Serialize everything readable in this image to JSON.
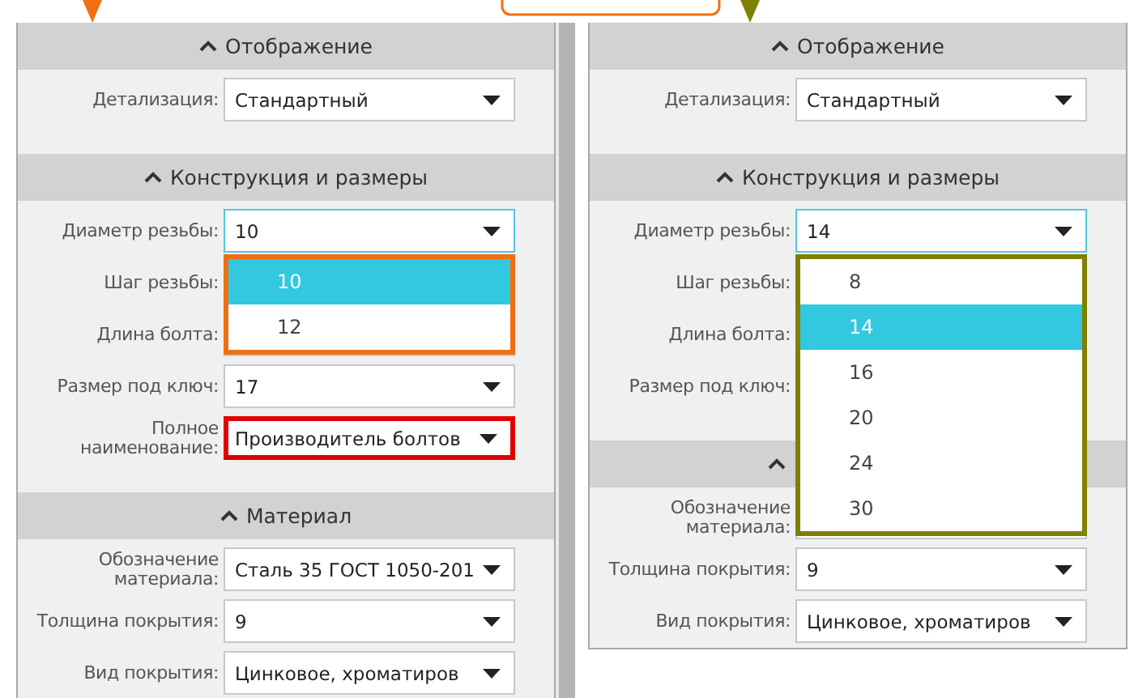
{
  "panels": [
    {
      "color": "#f07010",
      "sections": [
        {
          "title": "Отображение",
          "expanded": true,
          "rows": [
            {
              "label": "Детализация:",
              "value": "Стандартный",
              "focused": false,
              "highlighted": false
            }
          ]
        },
        {
          "title": "Конструкция и размеры",
          "expanded": true,
          "rows": [
            {
              "label": "Диаметр резьбы:",
              "value": "10",
              "focused": true,
              "highlighted": false,
              "options": [
                {
                  "label": "10",
                  "selected": true
                },
                {
                  "label": "12",
                  "selected": false
                }
              ]
            },
            {
              "label": "Шаг резьбы:"
            },
            {
              "label": "Длина болта:"
            },
            {
              "label": "Размер под ключ:",
              "value": "17",
              "focused": false,
              "highlighted": false
            },
            {
              "label": "Полное\nнаименование:",
              "value": "Производитель болтов",
              "focused": false,
              "highlighted": true
            }
          ]
        },
        {
          "title": "Материал",
          "expanded": true,
          "rows": [
            {
              "label": "Обозначение\nматериала:",
              "value": "Сталь 35 ГОСТ 1050-201",
              "focused": false,
              "highlighted": false
            },
            {
              "label": "Толщина покрытия:",
              "value": "9",
              "focused": false,
              "highlighted": false
            },
            {
              "label": "Вид покрытия:",
              "value": "Цинковое, хроматиров",
              "focused": false,
              "highlighted": false
            }
          ]
        }
      ]
    },
    {
      "color": "#808000",
      "sections": [
        {
          "title": "Отображение",
          "expanded": true,
          "rows": [
            {
              "label": "Детализация:",
              "value": "Стандартный",
              "focused": false,
              "highlighted": false
            }
          ]
        },
        {
          "title": "Конструкция и размеры",
          "expanded": true,
          "rows": [
            {
              "label": "Диаметр резьбы:",
              "value": "14",
              "focused": true,
              "highlighted": false,
              "options": [
                {
                  "label": "8",
                  "selected": false
                },
                {
                  "label": "14",
                  "selected": true
                },
                {
                  "label": "16",
                  "selected": false
                },
                {
                  "label": "20",
                  "selected": false
                },
                {
                  "label": "24",
                  "selected": false
                },
                {
                  "label": "30",
                  "selected": false
                }
              ]
            },
            {
              "label": "Шаг резьбы:"
            },
            {
              "label": "Длина болта:"
            },
            {
              "label": "Размер под ключ:"
            }
          ]
        },
        {
          "expanded": true,
          "rows": [
            {
              "label": "Обозначение\nматериала:"
            },
            {
              "label": "Толщина покрытия:",
              "value": "9",
              "focused": false,
              "highlighted": false
            },
            {
              "label": "Вид покрытия:",
              "value": "Цинковое, хроматиров",
              "focused": false,
              "highlighted": false
            }
          ]
        }
      ]
    }
  ]
}
